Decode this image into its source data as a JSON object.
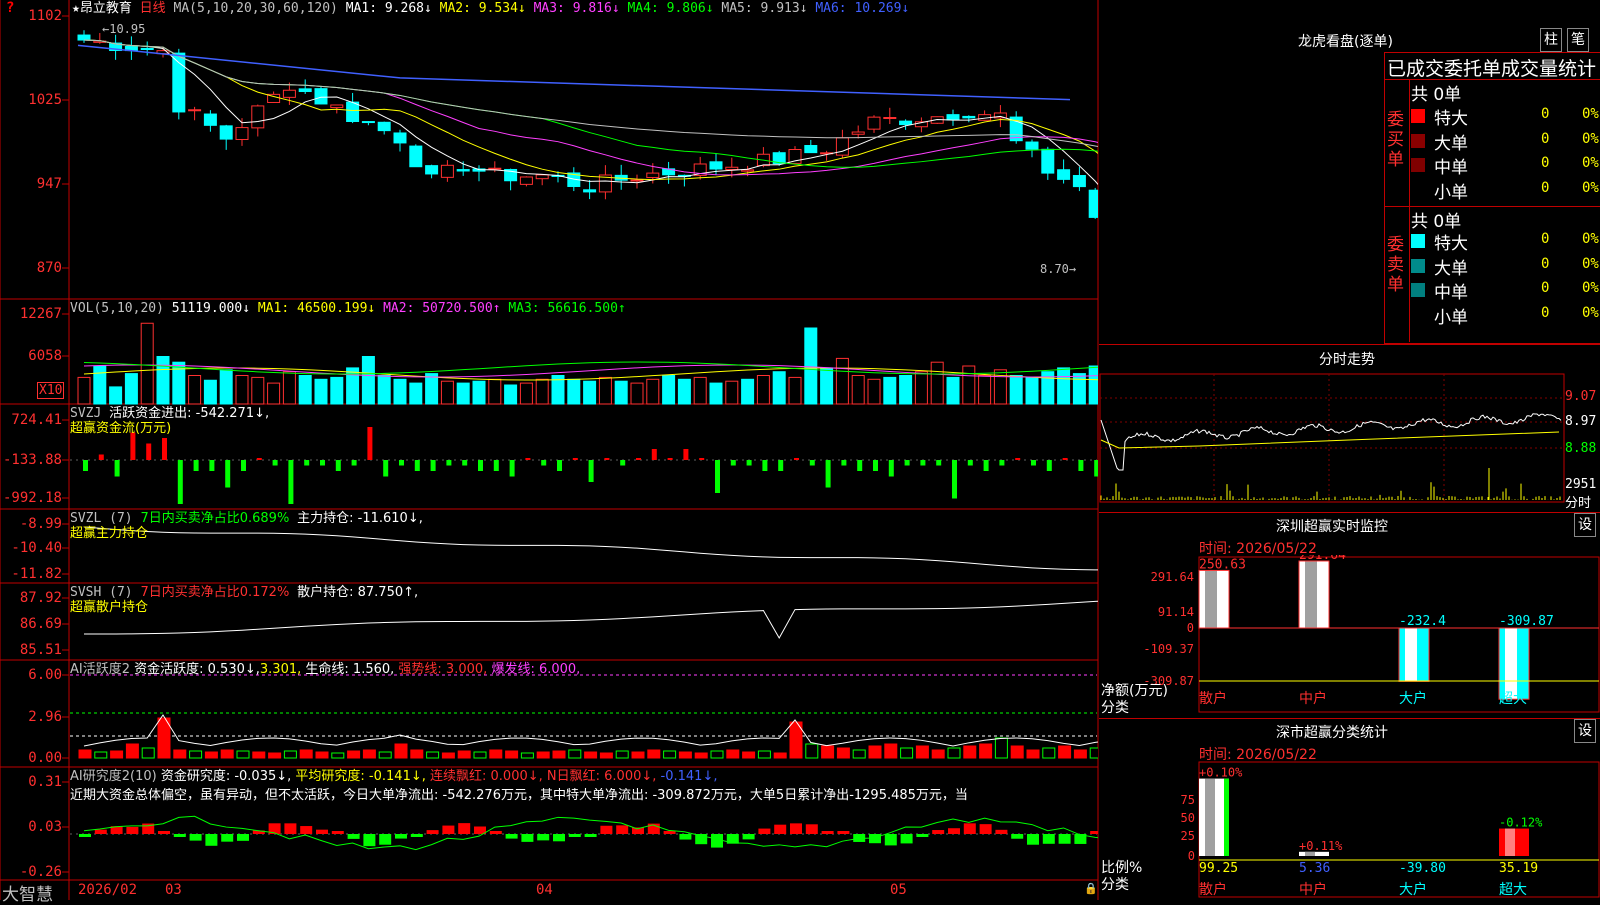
{
  "stock": {
    "star": "★",
    "name": "昂立教育",
    "period": "日线"
  },
  "main_legend": {
    "ma": "MA(5,10,20,30,60,120)",
    "ma1": "MA1: 9.268↓",
    "ma2": "MA2: 9.534↓",
    "ma3": "MA3: 9.816↓",
    "ma4": "MA4: 9.806↓",
    "ma5": "MA5: 9.913↓",
    "ma6": "MA6: 10.269↓"
  },
  "main_axis": [
    "1102",
    "1025",
    "947",
    "870"
  ],
  "main_notes": {
    "high": "10.95",
    "low": "8.70"
  },
  "vol_legend": {
    "name": "VOL(5,10,20)",
    "val": "51119.000↓",
    "ma1": "MA1: 46500.199↓",
    "ma2": "MA2: 50720.500↑",
    "ma3": "MA3: 56616.500↑"
  },
  "vol_axis": [
    "12267",
    "6058"
  ],
  "vol_unit": "X10",
  "svzj": {
    "name": "SVZJ",
    "label": "活跃资金进出: -542.271↓,",
    "sub": "超赢资金流(万元)",
    "axis": [
      "724.41",
      "-133.88",
      "-992.18"
    ]
  },
  "svzl": {
    "name": "SVZL (7)",
    "label1": "7日内买卖净占比0.689%",
    "label2": "主力持仓: -11.610↓,",
    "sub": "超赢主力持仓",
    "axis": [
      "-8.99",
      "-10.40",
      "-11.82"
    ]
  },
  "svsh": {
    "name": "SVSH (7)",
    "label1": "7日内买卖净占比0.172%",
    "label2": "散户持仓: 87.750↑,",
    "sub": "超赢散户持仓",
    "axis": [
      "87.92",
      "86.69",
      "85.51"
    ]
  },
  "ai1": {
    "name": "AI活跃度2",
    "l1": "资金活跃度: 0.530↓,",
    "l2": "3.301,",
    "l3": "生命线: 1.560,",
    "l4": "强势线: 3.000,",
    "l5": "爆发线: 6.000,",
    "axis": [
      "6.00",
      "2.96",
      "0.00"
    ]
  },
  "ai2": {
    "name": "AI研究度2(10)",
    "l1": "资金研究度: -0.035↓,",
    "l2": "平均研究度: -0.141↓,",
    "l3": "连续飘红: 0.000↓,",
    "l4": "N日飘红: 6.000↓,",
    "l5": "-0.141↓,",
    "desc": "近期大资金总体偏空，虽有异动，但不太活跃，今日大单净流出: -542.276万元，其中特大单净流出: -309.872万元，大单5日累计净出-1295.485万元，当",
    "axis": [
      "0.31",
      "0.03",
      "-0.26"
    ]
  },
  "date_axis": {
    "brand": "大智慧",
    "d1": "2026/02",
    "d2": "03",
    "d3": "04",
    "d4": "05"
  },
  "right": {
    "lhkp": "龙虎看盘(逐单)",
    "btn1": "柱",
    "btn2": "笔",
    "stats_title": "已成交委托单成交量统计",
    "buy": {
      "side": "委买单",
      "total": "共 0单",
      "rows": [
        {
          "k": "特大",
          "v": "0",
          "p": "0%",
          "c": "#ff0000"
        },
        {
          "k": "大单",
          "v": "0",
          "p": "0%",
          "c": "#8b0000"
        },
        {
          "k": "中单",
          "v": "0",
          "p": "0%",
          "c": "#800000"
        },
        {
          "k": "小单",
          "v": "0",
          "p": "0%",
          "c": ""
        }
      ]
    },
    "sell": {
      "side": "委卖单",
      "total": "共 0单",
      "rows": [
        {
          "k": "特大",
          "v": "0",
          "p": "0%",
          "c": "#00ffff"
        },
        {
          "k": "大单",
          "v": "0",
          "p": "0%",
          "c": "#008b8b"
        },
        {
          "k": "中单",
          "v": "0",
          "p": "0%",
          "c": "#007f7f"
        },
        {
          "k": "小单",
          "v": "0",
          "p": "0%",
          "c": ""
        }
      ]
    },
    "fenshi": {
      "title": "分时走势",
      "y": [
        "9.07",
        "8.97",
        "8.88"
      ],
      "vol": "2951",
      "vol_unit": "分时"
    },
    "monitor": {
      "title": "深圳超赢实时监控",
      "btn": "设",
      "time": "时间: 2026/05/22",
      "axis": [
        "291.64",
        "91.14",
        "0",
        "-109.37",
        "-309.87"
      ],
      "ylab": "净额(万元)",
      "xlab": "分类",
      "cats": [
        "散户",
        "中户",
        "大户",
        "超大"
      ],
      "vals": [
        "250.63",
        "291.64",
        "-232.4",
        "-309.87"
      ]
    },
    "classify": {
      "title": "深市超赢分类统计",
      "btn": "设",
      "time": "时间: 2026/05/22",
      "axis": [
        "75",
        "50",
        "25",
        "0"
      ],
      "ylab": "比例%",
      "xlab": "分类",
      "cats": [
        "散户",
        "中户",
        "大户",
        "超大"
      ],
      "tops": [
        "+0.10%",
        "+0.11%",
        "",
        "-0.12%"
      ],
      "vals": [
        "99.25",
        "5.36",
        "-39.80",
        "35.19"
      ]
    }
  },
  "colors": {
    "up": "#ff3030",
    "down": "#00ffff",
    "border": "#c00000"
  }
}
